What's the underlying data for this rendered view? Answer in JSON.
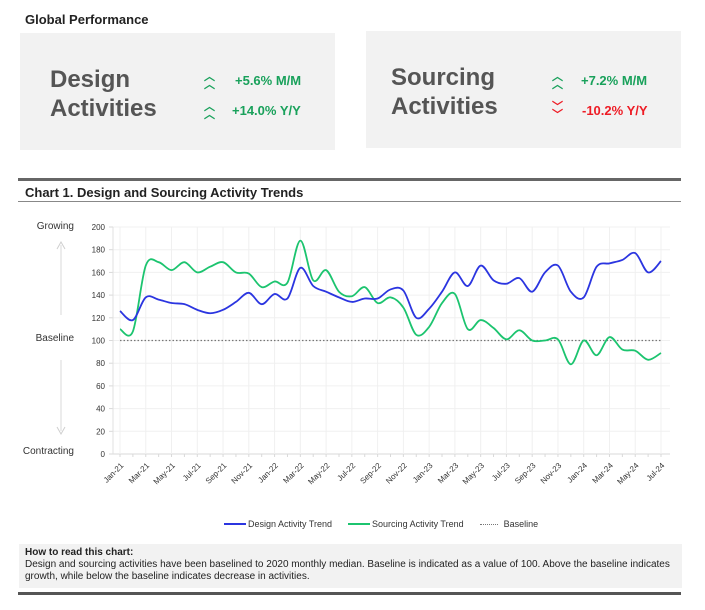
{
  "header": {
    "title": "Global Performance"
  },
  "cards": [
    {
      "name_line1": "Design",
      "name_line2": "Activities",
      "metrics": [
        {
          "value": "+5.6% M/M",
          "direction": "up",
          "icon": "double-chevron-up-icon"
        },
        {
          "value": "+14.0% Y/Y",
          "direction": "up",
          "icon": "double-chevron-up-icon"
        }
      ]
    },
    {
      "name_line1": "Sourcing",
      "name_line2": "Activities",
      "metrics": [
        {
          "value": "+7.2% M/M",
          "direction": "up",
          "icon": "double-chevron-up-icon"
        },
        {
          "value": "-10.2% Y/Y",
          "direction": "down",
          "icon": "double-chevron-down-icon"
        }
      ]
    }
  ],
  "colors": {
    "up": "#19a15b",
    "down": "#ee1c25",
    "design": "#2b35e0",
    "sourcing": "#1cc46f",
    "baseline": "#777777"
  },
  "side_labels": {
    "top": "Growing",
    "middle": "Baseline",
    "bottom": "Contracting"
  },
  "note": {
    "heading": "How to read this chart:",
    "body": "Design and sourcing activities have  been baselined to 2020 monthly median. Baseline is indicated as  a value of 100. Above the baseline indicates growth, while below the baseline indicates decrease in activities."
  },
  "chart_data": {
    "type": "line",
    "title": "Chart 1. Design and Sourcing Activity Trends",
    "xlabel": "",
    "ylabel": "",
    "ylim": [
      0,
      200
    ],
    "yticks": [
      0,
      20,
      40,
      60,
      80,
      100,
      120,
      140,
      160,
      180,
      200
    ],
    "grid": true,
    "legend_position": "bottom",
    "x": [
      "Jan-21",
      "Feb-21",
      "Mar-21",
      "Apr-21",
      "May-21",
      "Jun-21",
      "Jul-21",
      "Aug-21",
      "Sep-21",
      "Oct-21",
      "Nov-21",
      "Dec-21",
      "Jan-22",
      "Feb-22",
      "Mar-22",
      "Apr-22",
      "May-22",
      "Jun-22",
      "Jul-22",
      "Aug-22",
      "Sep-22",
      "Oct-22",
      "Nov-22",
      "Dec-22",
      "Jan-23",
      "Feb-23",
      "Mar-23",
      "Apr-23",
      "May-23",
      "Jun-23",
      "Jul-23",
      "Aug-23",
      "Sep-23",
      "Oct-23",
      "Nov-23",
      "Dec-23",
      "Jan-24",
      "Feb-24",
      "Mar-24",
      "Apr-24",
      "May-24",
      "Jun-24",
      "Jul-24"
    ],
    "xtick_labels": [
      "Jan-21",
      "Mar-21",
      "May-21",
      "Jul-21",
      "Sep-21",
      "Nov-21",
      "Jan-22",
      "Mar-22",
      "May-22",
      "Jul-22",
      "Sep-22",
      "Nov-22",
      "Jan-23",
      "Mar-23",
      "May-23",
      "Jul-23",
      "Sep-23",
      "Nov-23",
      "Jan-24",
      "Mar-24",
      "May-24",
      "Jul-24"
    ],
    "series": [
      {
        "name": "Design Activity Trend",
        "style": "solid",
        "values": [
          126,
          118,
          138,
          136,
          133,
          132,
          127,
          124,
          127,
          134,
          142,
          132,
          141,
          137,
          164,
          148,
          143,
          138,
          134,
          137,
          137,
          145,
          144,
          120,
          128,
          143,
          160,
          148,
          166,
          153,
          150,
          155,
          143,
          160,
          166,
          143,
          138,
          165,
          168,
          171,
          177,
          160,
          170
        ]
      },
      {
        "name": "Sourcing Activity Trend",
        "style": "solid",
        "values": [
          110,
          108,
          166,
          169,
          162,
          169,
          160,
          165,
          169,
          160,
          159,
          147,
          152,
          151,
          188,
          153,
          162,
          143,
          139,
          147,
          133,
          138,
          129,
          105,
          112,
          133,
          141,
          110,
          118,
          111,
          101,
          109,
          100,
          100,
          101,
          79,
          100,
          87,
          103,
          92,
          91,
          83,
          89
        ]
      },
      {
        "name": "Baseline",
        "style": "dotted",
        "values": [
          100,
          100,
          100,
          100,
          100,
          100,
          100,
          100,
          100,
          100,
          100,
          100,
          100,
          100,
          100,
          100,
          100,
          100,
          100,
          100,
          100,
          100,
          100,
          100,
          100,
          100,
          100,
          100,
          100,
          100,
          100,
          100,
          100,
          100,
          100,
          100,
          100,
          100,
          100,
          100,
          100,
          100,
          100
        ]
      }
    ]
  }
}
